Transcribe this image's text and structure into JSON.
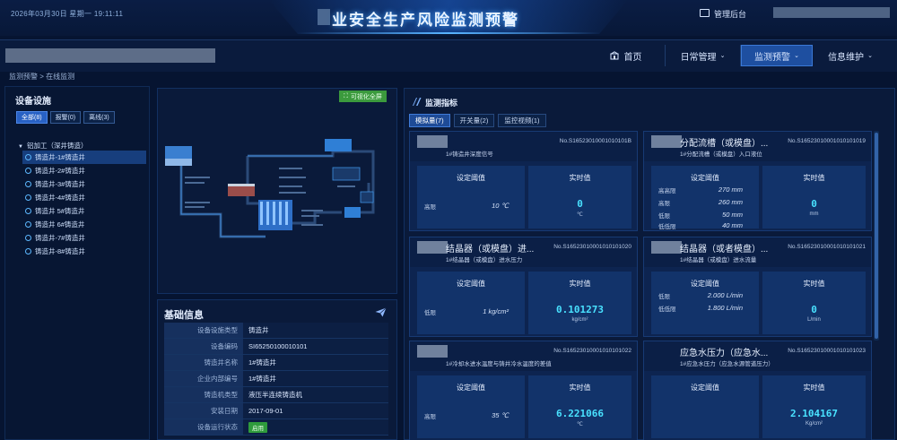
{
  "header": {
    "datetime": "2026年03月30日 星期一 19:11:11",
    "title": "业安全生产风险监测预警",
    "admin_label": "管理后台"
  },
  "nav": [
    {
      "label": "首页",
      "icon": "home-icon",
      "active": false
    },
    {
      "label": "日常管理",
      "active": false,
      "dropdown": true
    },
    {
      "label": "监测预警",
      "active": true,
      "dropdown": true
    },
    {
      "label": "信息维护",
      "active": false,
      "dropdown": true
    }
  ],
  "breadcrumb": "监测预警 > 在线监测",
  "devices": {
    "title": "设备设施",
    "filters": [
      {
        "label": "全部(8)",
        "active": true
      },
      {
        "label": "报警(0)",
        "active": false
      },
      {
        "label": "离线(3)",
        "active": false
      }
    ],
    "root": "铝加工（深井铸造）",
    "items": [
      {
        "label": "铸造井-1#铸造井",
        "active": true
      },
      {
        "label": "铸造井-2#铸造井",
        "active": false
      },
      {
        "label": "铸造井-3#铸造井",
        "active": false
      },
      {
        "label": "铸造井-4#铸造井",
        "active": false
      },
      {
        "label": "铸造井 5#铸造井",
        "active": false
      },
      {
        "label": "铸造井 6#铸造井",
        "active": false
      },
      {
        "label": "铸造井-7#铸造井",
        "active": false
      },
      {
        "label": "铸造井-8#铸造井",
        "active": false
      }
    ]
  },
  "flow": {
    "fullscreen_label": "可视化全屏"
  },
  "info": {
    "title": "基础信息",
    "rows": [
      {
        "k": "设备设施类型",
        "v": "铸造井"
      },
      {
        "k": "设备编码",
        "v": "SI65250100010101"
      },
      {
        "k": "铸造井名称",
        "v": "1#铸造井"
      },
      {
        "k": "企业内部编号",
        "v": "1#铸造井"
      },
      {
        "k": "铸造机类型",
        "v": "液压半连续铸造机"
      },
      {
        "k": "安装日期",
        "v": "2017-09-01"
      },
      {
        "k": "设备运行状态",
        "v": "启用",
        "badge": true
      }
    ]
  },
  "monitor": {
    "title": "监测指标",
    "tabs": [
      {
        "label": "模拟量(7)",
        "active": true
      },
      {
        "label": "开关量(2)",
        "active": false
      },
      {
        "label": "监控视频(1)",
        "active": false
      }
    ],
    "threshold_label": "设定阈值",
    "realtime_label": "实时值",
    "cards": [
      {
        "name": "",
        "code": "No.S16523010001010101B",
        "sub": "1#铸造井深度信号",
        "thresholds": [
          {
            "k": "高限",
            "v": "10 ℃"
          }
        ],
        "value": "0",
        "unit": "℃",
        "masked": true
      },
      {
        "name": "分配流槽（或模盘）...",
        "code": "No.S16523010001010101019",
        "sub": "1#分配流槽（或模盘）入口液位",
        "thresholds": [
          {
            "k": "高高限",
            "v": "270 mm"
          },
          {
            "k": "高限",
            "v": "260 mm"
          },
          {
            "k": "低限",
            "v": "50 mm"
          },
          {
            "k": "低低限",
            "v": "40 mm"
          }
        ],
        "value": "0",
        "unit": "mm",
        "masked": true
      },
      {
        "name": "结晶器（或模盘）进...",
        "code": "No.S16523010001010101020",
        "sub": "1#结晶器（或模盘）进水压力",
        "thresholds": [
          {
            "k": "低限",
            "v": "1 kg/cm²"
          }
        ],
        "value": "0.101273",
        "unit": "kg/cm²",
        "masked": true
      },
      {
        "name": "结晶器（或者模盘）...",
        "code": "No.S16523010001010101021",
        "sub": "1#结晶器（或模盘）进水流量",
        "thresholds": [
          {
            "k": "低限",
            "v": "2.000 L/min"
          },
          {
            "k": "低低限",
            "v": "1.800 L/min"
          }
        ],
        "value": "0",
        "unit": "L/min",
        "masked": true
      },
      {
        "name": "",
        "code": "No.S16523010001010101022",
        "sub": "1#冷却水进水温度与铸井冷水温度的差值",
        "thresholds": [
          {
            "k": "高限",
            "v": "35 ℃"
          }
        ],
        "value": "6.221066",
        "unit": "℃",
        "masked": true
      },
      {
        "name": "应急水压力（应急水...",
        "code": "No.S16523010001010101023",
        "sub": "1#应急水压力（应急水源管道压力）",
        "thresholds": [],
        "value": "2.104167",
        "unit": "Kg/cm²",
        "masked": false
      }
    ]
  },
  "colors": {
    "accent": "#1e4fa0",
    "value_cyan": "#49e2ff",
    "ok_green": "#2f9b3c",
    "background": "#061431"
  }
}
